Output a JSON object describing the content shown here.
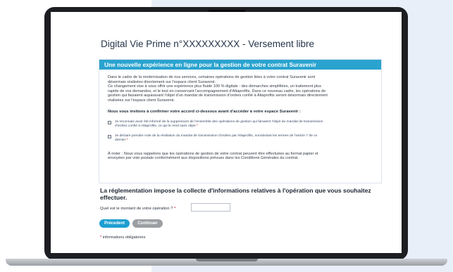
{
  "page": {
    "title": "Digital Vie Prime n°XXXXXXXXX - Versement libre"
  },
  "panel": {
    "header": "Une nouvelle expérience en ligne pour la gestion de votre contrat Suravenir",
    "intro_lines": [
      "Dans le cadre de la modernisation de nos services, certaines opérations de gestion liées à votre contrat Suravenir sont",
      "désormais réalisées directement sur l'espace client Suravenir.",
      "Ce changement vise à vous offrir une expérience plus fluide 100 % digitale : des démarches simplifiées, un traitement plus",
      "rapide de vos demandes, et le tout en conservant l'accompagnement d'Altaprofits. Dans ce nouveau cadre, les opérations de",
      "gestion qui faisaient auparavant l'objet d'un mandat de transmission d'ordres confié à Altaprofits seront désormais directement",
      "réalisées sur l'espace client Suravenir."
    ],
    "invite": "Nous vous invitons à confirmer votre accord ci-dessous avant d'accéder à votre espace Suravenir :",
    "checks": [
      {
        "line1": "Je reconnais avoir été informé de la suppression de l'ensemble des opérations de gestion qui faisaient l'objet du mandat de transmission",
        "line2": "d'ordres confié à Altaprofits, ce qui le rend sans objet",
        "star": "*"
      },
      {
        "line1": "Je déclare prendre note de la résiliation du mandat de transmission d'ordres par Altaprofits, nonobstant les termes de l'article 7 de ce",
        "line2": "dernier",
        "star": "*"
      }
    ],
    "note_lines": [
      "À noter : Nous vous rappelons que les opérations de gestion de votre contrat peuvent être effectuées au format papier et",
      "envoyées par voie postale conformément aux dispositions prévues dans les Conditions Générales du contrat."
    ]
  },
  "form": {
    "heading": "La réglementation impose la collecte d'informations relatives à l'opération que vous souhaitez effectuer.",
    "amount_label": "Quel est le montant de votre opération ?",
    "amount_star": "*",
    "amount_value": ""
  },
  "buttons": {
    "previous": "Précedent",
    "continue": "Continuer"
  },
  "footer": {
    "star": "*",
    "required_note": "informations obligatoires"
  },
  "colors": {
    "header_bg": "#2aa3cf",
    "primary_button": "#1e9fd1",
    "disabled_button": "#9b9fa3",
    "required_star": "#d0021b",
    "background_accent": "#e8eff8"
  }
}
